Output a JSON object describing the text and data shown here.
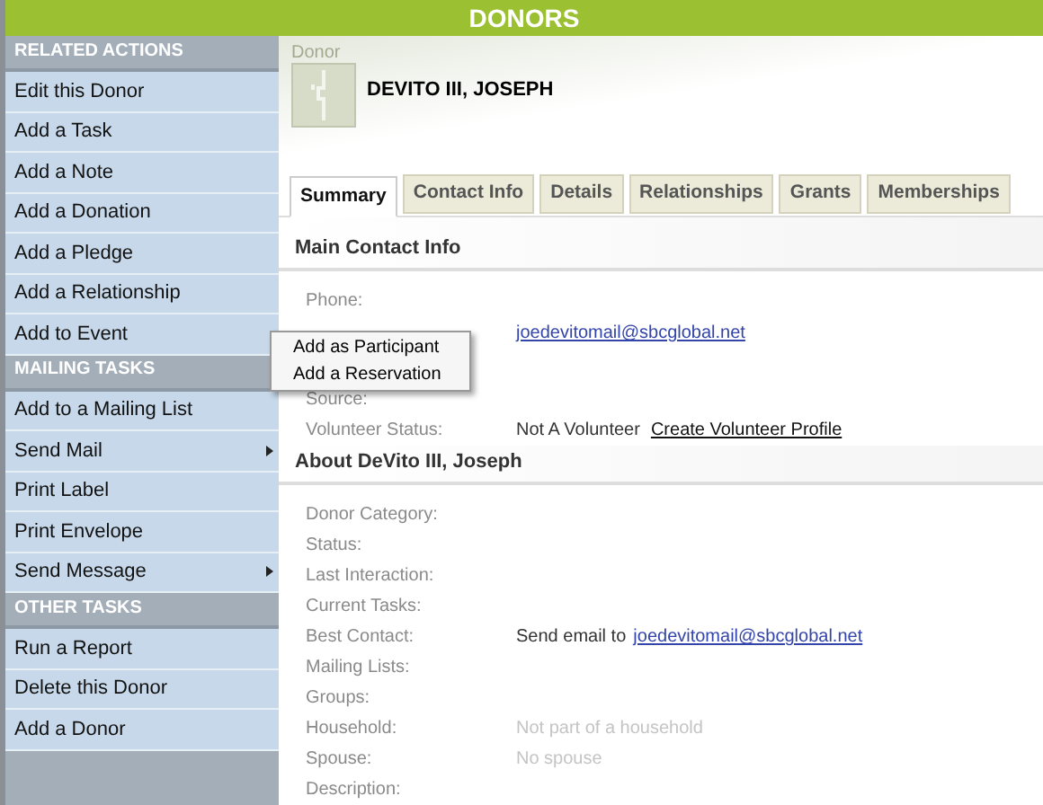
{
  "header": {
    "title": "DONORS"
  },
  "sidebar": {
    "sections": [
      {
        "title": "RELATED ACTIONS",
        "items": [
          {
            "label": "Edit this Donor",
            "submenu": false
          },
          {
            "label": "Add a Task",
            "submenu": false
          },
          {
            "label": "Add a Note",
            "submenu": false
          },
          {
            "label": "Add a Donation",
            "submenu": false
          },
          {
            "label": "Add a Pledge",
            "submenu": false
          },
          {
            "label": "Add a Relationship",
            "submenu": false
          },
          {
            "label": "Add to Event",
            "submenu": false
          }
        ]
      },
      {
        "title": "MAILING TASKS",
        "items": [
          {
            "label": "Add to a Mailing List",
            "submenu": false
          },
          {
            "label": "Send Mail",
            "submenu": true
          },
          {
            "label": "Print Label",
            "submenu": false
          },
          {
            "label": "Print Envelope",
            "submenu": false
          },
          {
            "label": "Send Message",
            "submenu": true
          }
        ]
      },
      {
        "title": "OTHER TASKS",
        "items": [
          {
            "label": "Run a Report",
            "submenu": false
          },
          {
            "label": "Delete this Donor",
            "submenu": false
          },
          {
            "label": "Add a Donor",
            "submenu": false
          }
        ]
      }
    ]
  },
  "popup_menu": {
    "items": [
      "Add as Participant",
      "Add a Reservation"
    ]
  },
  "record": {
    "type_label": "Donor",
    "name": "DEVITO III, JOSEPH"
  },
  "tabs": [
    {
      "label": "Summary",
      "selected": true
    },
    {
      "label": "Contact Info",
      "selected": false
    },
    {
      "label": "Details",
      "selected": false
    },
    {
      "label": "Relationships",
      "selected": false
    },
    {
      "label": "Grants",
      "selected": false
    },
    {
      "label": "Memberships",
      "selected": false
    }
  ],
  "main_contact": {
    "title": "Main Contact Info",
    "rows": [
      {
        "kind": "text",
        "label": "Phone:"
      },
      {
        "kind": "covered",
        "link": "joedevitomail@sbcglobal.net"
      },
      {
        "kind": "text",
        "label": "Source:"
      },
      {
        "kind": "action",
        "label": "Volunteer Status:",
        "value": "Not A Volunteer",
        "link": "Create Volunteer Profile"
      }
    ]
  },
  "about": {
    "title": "About DeVito III, Joseph",
    "rows": [
      {
        "kind": "text",
        "label": "Donor Category:"
      },
      {
        "kind": "text",
        "label": "Status:"
      },
      {
        "kind": "text",
        "label": "Last Interaction:"
      },
      {
        "kind": "text",
        "label": "Current Tasks:"
      },
      {
        "kind": "email",
        "label": "Best Contact:",
        "value": "Send email to",
        "link": "joedevitomail@sbcglobal.net"
      },
      {
        "kind": "text",
        "label": "Mailing Lists:"
      },
      {
        "kind": "text",
        "label": "Groups:"
      },
      {
        "kind": "muted",
        "label": "Household:",
        "value": "Not part of a household"
      },
      {
        "kind": "muted",
        "label": "Spouse:",
        "value": "No spouse"
      },
      {
        "kind": "text",
        "label": "Description:"
      }
    ]
  }
}
